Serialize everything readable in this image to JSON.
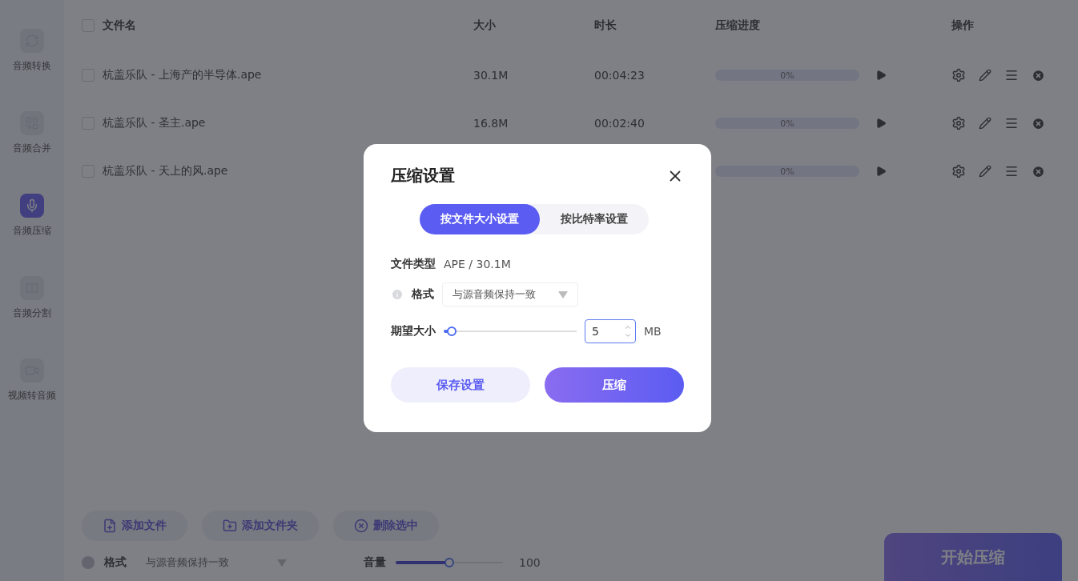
{
  "sidebar": {
    "items": [
      {
        "label": "音频转换",
        "selected": false
      },
      {
        "label": "音频合并",
        "selected": false
      },
      {
        "label": "音频压缩",
        "selected": true
      },
      {
        "label": "音频分割",
        "selected": false
      },
      {
        "label": "视频转音频",
        "selected": false
      }
    ]
  },
  "table": {
    "select_all": {
      "checked": false
    },
    "columns": [
      "文件名",
      "大小",
      "时长",
      "压缩进度",
      "操作"
    ],
    "rows": [
      {
        "checked": false,
        "name": "杭盖乐队 - 上海产的半导体.ape",
        "size": "30.1M",
        "duration": "00:04:23",
        "level": 0,
        "progress": "0%"
      },
      {
        "checked": false,
        "name": "杭盖乐队 - 圣主.ape",
        "size": "16.8M",
        "duration": "00:02:40",
        "level": 0,
        "progress": "0%"
      },
      {
        "checked": false,
        "name": "杭盖乐队 - 天上的风.ape",
        "level": 0,
        "progress": "0%"
      }
    ]
  },
  "toolbar": [
    {
      "label": "添加文件",
      "kind": "file"
    },
    {
      "label": "添加文件夹",
      "kind": "folder"
    },
    {
      "label": "删除选中",
      "kind": "delete"
    }
  ],
  "format": {
    "label": "格式",
    "value": "与源音频保持一致"
  },
  "volume": {
    "label": "音量",
    "level": 0.5,
    "reading": "100"
  },
  "start_button": "开始压缩",
  "dialog": {
    "title": "压缩设置",
    "tabs": [
      {
        "label": "按文件大小设置",
        "selected": true
      },
      {
        "label": "按比特率设置",
        "selected": false
      }
    ],
    "file_type": {
      "label": "文件类型",
      "value": "APE / 30.1M"
    },
    "format": {
      "label": "格式",
      "value": "与源音频保持一致"
    },
    "target_size": {
      "label": "期望大小",
      "level": 0.06,
      "value": "5",
      "unit": "MB"
    },
    "buttons": [
      {
        "label": "保存设置",
        "kind": "secondary"
      },
      {
        "label": "压缩",
        "kind": "primary"
      }
    ]
  }
}
